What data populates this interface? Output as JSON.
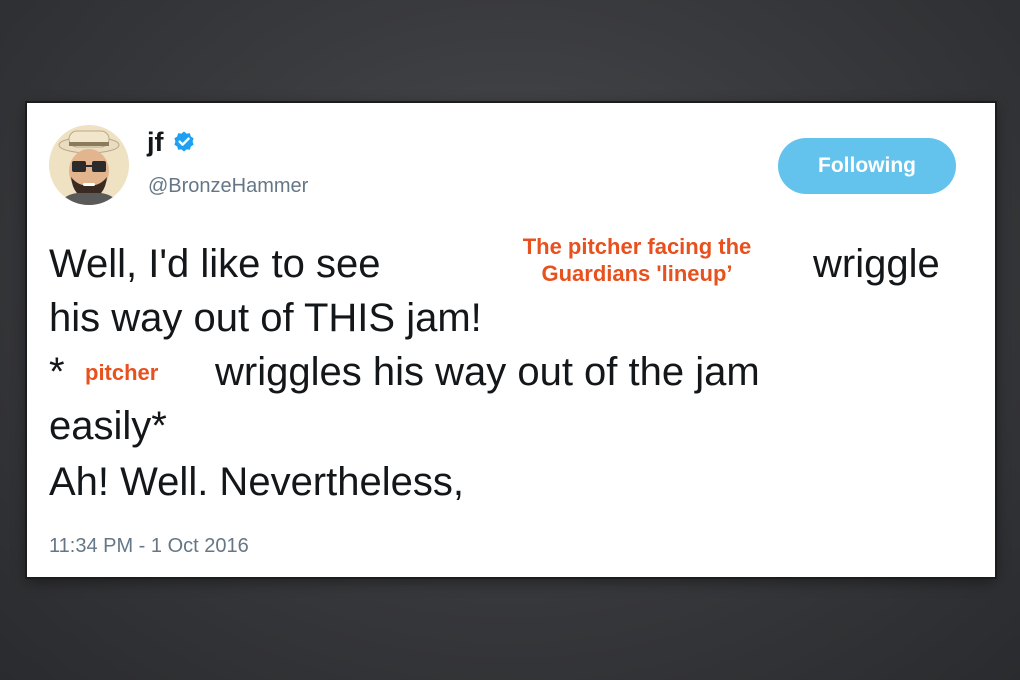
{
  "tweet": {
    "author": {
      "display_name": "jf",
      "handle": "@BronzeHammer",
      "verified_icon": "verified-badge-icon",
      "avatar_icon": "cartoon-avatar-icon"
    },
    "follow_button_label": "Following",
    "lines": [
      "Well, I'd like to see",
      "wriggle",
      "his way out of THIS jam!",
      "*",
      "wriggles his way out of the jam",
      "easily*",
      "Ah! Well. Nevertheless,"
    ],
    "timestamp": "11:34 PM - 1 Oct 2016"
  },
  "overlays": {
    "subject_line1": "The pitcher facing the",
    "subject_line2": "Guardians 'lineup’",
    "pitcher": "pitcher"
  },
  "colors": {
    "follow_button": "#64c3ec",
    "overlay_text": "#e8501e",
    "verified": "#1da1f2",
    "handle_text": "#657786"
  }
}
